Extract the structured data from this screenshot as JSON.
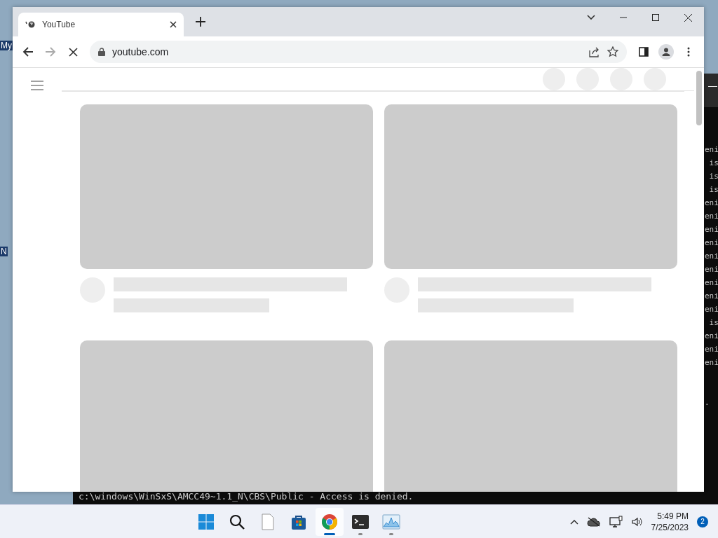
{
  "desktop": {
    "icon_labels": [
      "My",
      "N"
    ]
  },
  "terminal": {
    "minimize": "—",
    "line_fragments": [
      "eni",
      "is",
      "is",
      "is",
      "eni",
      "eni",
      "eni",
      "eni",
      "eni",
      "eni",
      "eni",
      "eni",
      "eni",
      "is",
      "eni",
      "eni",
      "eni"
    ],
    "cursor_line": ".",
    "last_line": "c:\\windows\\WinSxS\\AMCC49~1.1_N\\CBS\\Public - Access is denied."
  },
  "browser": {
    "tabs": [
      {
        "title": "YouTube",
        "selected": true
      }
    ],
    "address": "youtube.com",
    "loading": true
  },
  "taskbar": {
    "apps": [
      {
        "kind": "start",
        "selected": false,
        "running": false
      },
      {
        "kind": "search",
        "selected": false,
        "running": false
      },
      {
        "kind": "file",
        "selected": false,
        "running": false
      },
      {
        "kind": "store",
        "selected": false,
        "running": false
      },
      {
        "kind": "chrome",
        "selected": true,
        "running": true
      },
      {
        "kind": "terminal",
        "selected": false,
        "running": true
      },
      {
        "kind": "monitor",
        "selected": false,
        "running": true
      }
    ],
    "time": "5:49 PM",
    "date": "7/25/2023",
    "notification_count": "2"
  }
}
